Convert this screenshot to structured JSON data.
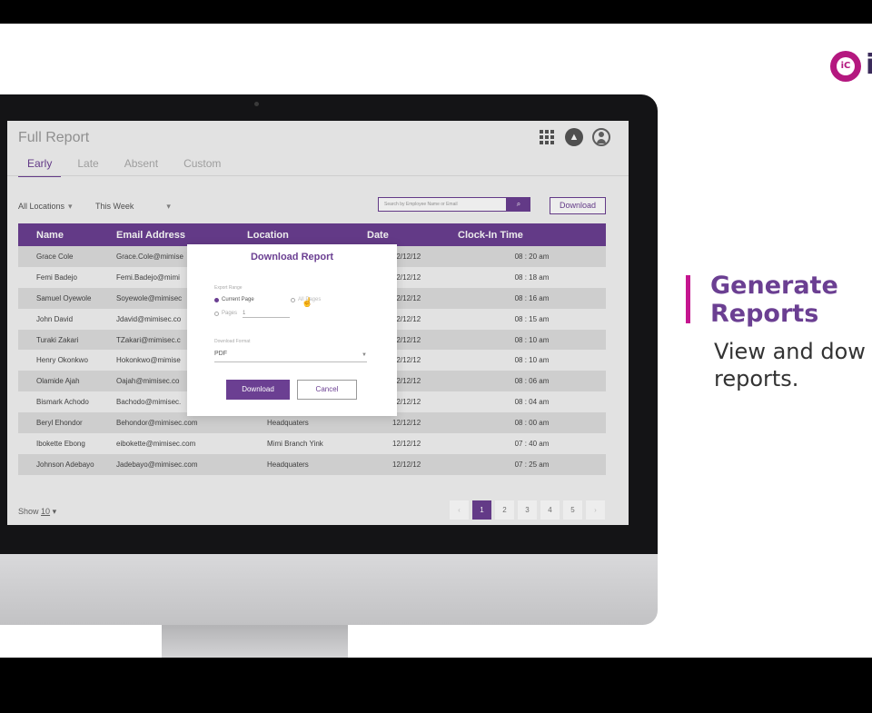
{
  "brand": {
    "logo_text": "iC",
    "partial_text": "i"
  },
  "app": {
    "title": "Full Report",
    "apps_icon": "grid-icon",
    "notification_icon": "bell-icon",
    "profile_icon": "avatar-icon"
  },
  "tabs": [
    "Early",
    "Late",
    "Absent",
    "Custom"
  ],
  "filters": {
    "location": "All Locations",
    "period": "This Week"
  },
  "search": {
    "placeholder": "Search by Employee Name or Email",
    "button_icon": "search-icon"
  },
  "download_button": "Download",
  "table": {
    "headers": [
      "Name",
      "Email Address",
      "Location",
      "Date",
      "Clock-In Time"
    ],
    "rows": [
      [
        "Grace Cole",
        "Grace.Cole@mimise",
        "",
        "12/12/12",
        "08 : 20 am"
      ],
      [
        "Femi Badejo",
        "Femi.Badejo@mimi",
        "",
        "12/12/12",
        "08 : 18 am"
      ],
      [
        "Samuel Oyewole",
        "Soyewole@mimisec",
        "",
        "12/12/12",
        "08 : 16 am"
      ],
      [
        "John David",
        "Jdavid@mimisec.co",
        "",
        "12/12/12",
        "08 : 15 am"
      ],
      [
        "Turaki Zakari",
        "TZakari@mimisec.c",
        "",
        "12/12/12",
        "08 : 10 am"
      ],
      [
        "Henry Okonkwo",
        "Hokonkwo@mimise",
        "",
        "12/12/12",
        "08 : 10 am"
      ],
      [
        "Olamide Ajah",
        "Oajah@mimisec.co",
        "",
        "12/12/12",
        "08 : 06 am"
      ],
      [
        "Bismark Achodo",
        "Bachodo@mimisec.",
        "",
        "12/12/12",
        "08 : 04 am"
      ],
      [
        "Beryl Ehondor",
        "Behondor@mimisec.com",
        "Headquaters",
        "12/12/12",
        "08 : 00 am"
      ],
      [
        "Ibokette Ebong",
        "eibokette@mimisec.com",
        "Mimi Branch Yink",
        "12/12/12",
        "07 : 40 am"
      ],
      [
        "Johnson Adebayo",
        "Jadebayo@mimisec.com",
        "Headquaters",
        "12/12/12",
        "07 : 25 am"
      ]
    ]
  },
  "show": {
    "label": "Show",
    "value": "10"
  },
  "pagination": {
    "prev": "‹",
    "pages": [
      "1",
      "2",
      "3",
      "4",
      "5"
    ],
    "next": "›",
    "current": "1"
  },
  "modal": {
    "title": "Download Report",
    "export_range_label": "Export Range",
    "option_current": "Current Page",
    "option_all": "All Pages",
    "option_pages": "Pages",
    "pages_value": "1",
    "format_label": "Download Format",
    "format_value": "PDF",
    "download_button": "Download",
    "cancel_button": "Cancel"
  },
  "promo": {
    "title": "Generate\nReports",
    "description": "View and dow\nreports."
  },
  "colors": {
    "accent": "#6b3f92",
    "brand": "#c5158f"
  }
}
